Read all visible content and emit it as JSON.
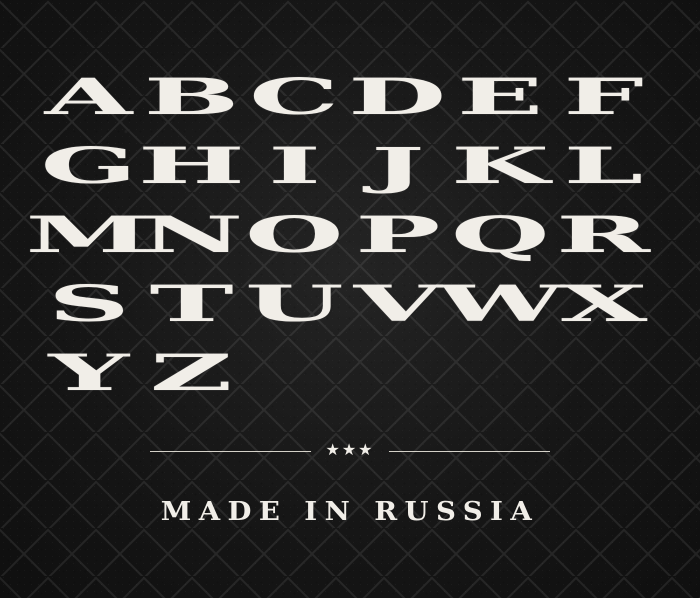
{
  "alphabet": {
    "letters": [
      "A",
      "B",
      "C",
      "D",
      "E",
      "F",
      "G",
      "H",
      "I",
      "J",
      "K",
      "L",
      "M",
      "N",
      "O",
      "P",
      "Q",
      "R",
      "S",
      "T",
      "U",
      "V",
      "W",
      "X",
      "Y",
      "Z"
    ]
  },
  "ornament": {
    "stars": "★★★"
  },
  "footer": {
    "text": "MADE IN RUSSIA"
  },
  "colors": {
    "background": "#181818",
    "foreground": "#f1eee8"
  }
}
